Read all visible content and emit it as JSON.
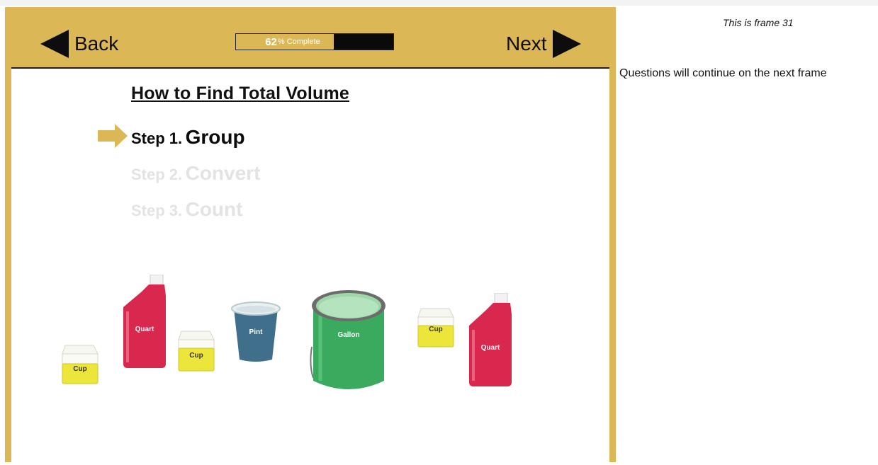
{
  "nav": {
    "back_label": "Back",
    "next_label": "Next",
    "progress_percent": "62",
    "progress_suffix": "% Complete",
    "progress_fraction": 0.62
  },
  "lesson": {
    "title": "How to Find Total Volume",
    "steps": [
      {
        "num": "Step 1.",
        "name": "Group",
        "active": true
      },
      {
        "num": "Step 2.",
        "name": "Convert",
        "active": false
      },
      {
        "num": "Step 3.",
        "name": "Count",
        "active": false
      }
    ],
    "containers": {
      "cup1": "Cup",
      "quart1": "Quart",
      "cup2": "Cup",
      "pint": "Pint",
      "gallon": "Gallon",
      "cup3": "Cup",
      "quart2": "Quart"
    }
  },
  "sidebar": {
    "frame_note": "This is frame 31",
    "continue_note": "Questions will continue on the next frame"
  },
  "colors": {
    "frame_gold": "#dcb756",
    "quart_red": "#d8284d",
    "cup_yellow": "#ece53a",
    "pint_blue": "#3f6f8a",
    "gallon_green": "#3aaa5f"
  }
}
